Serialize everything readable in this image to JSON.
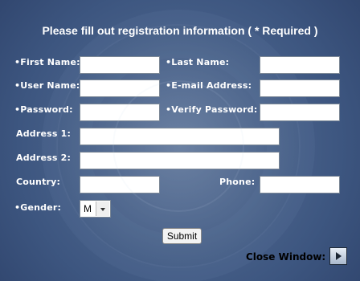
{
  "form": {
    "title": "Please fill out registration information ( * Required )",
    "labels": {
      "first_name": "•First Name:",
      "last_name": "•Last Name:",
      "user_name": "•User Name:",
      "email": "•E-mail Address:",
      "password": "•Password:",
      "verify_password": "•Verify Password:",
      "address1": "Address 1:",
      "address2": "Address 2:",
      "country": "Country:",
      "phone": "Phone:",
      "gender": "•Gender:"
    },
    "values": {
      "first_name": "",
      "last_name": "",
      "user_name": "",
      "email": "",
      "password": "",
      "verify_password": "",
      "address1": "",
      "address2": "",
      "country": "",
      "phone": ""
    },
    "gender_selected": "M",
    "submit_label": "Submit",
    "close_label": "Close Window:"
  },
  "icons": {
    "close": "play-arrow-icon",
    "select": "chevron-down-icon"
  },
  "colors": {
    "background": "#3d5680",
    "label_text": "#ffffff"
  }
}
